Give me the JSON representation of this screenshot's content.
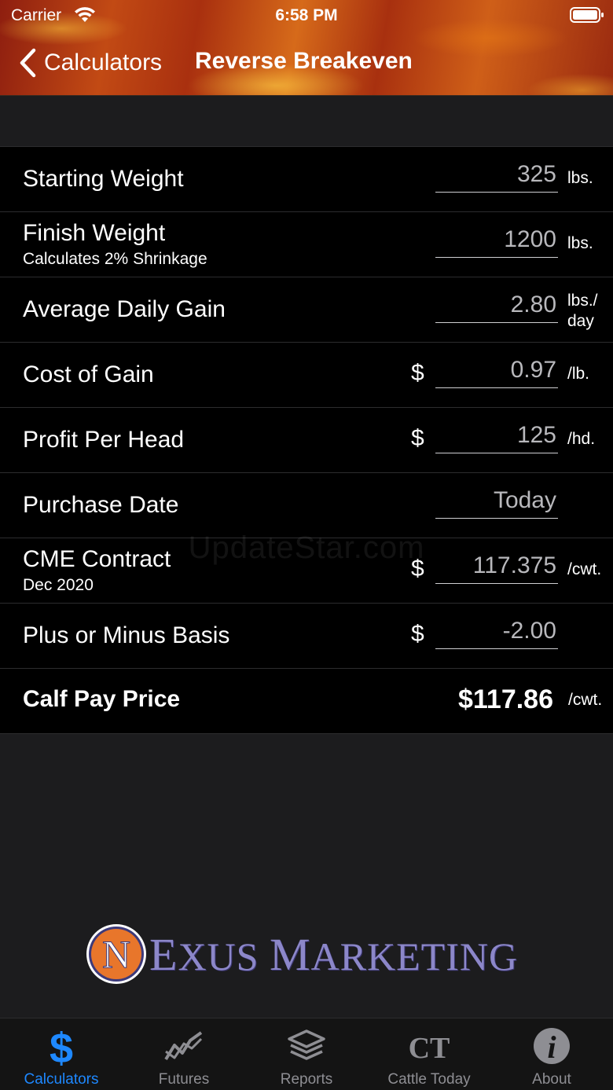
{
  "status_bar": {
    "carrier": "Carrier",
    "time": "6:58 PM"
  },
  "nav": {
    "back_label": "Calculators",
    "title": "Reverse Breakeven"
  },
  "form": {
    "starting_weight": {
      "label": "Starting Weight",
      "value": "325",
      "unit": "lbs."
    },
    "finish_weight": {
      "label": "Finish Weight",
      "sublabel": "Calculates 2% Shrinkage",
      "value": "1200",
      "unit": "lbs."
    },
    "average_daily_gain": {
      "label": "Average Daily Gain",
      "value": "2.80",
      "unit_line1": "lbs./",
      "unit_line2": "day"
    },
    "cost_of_gain": {
      "label": "Cost of Gain",
      "currency": "$",
      "value": "0.97",
      "unit": "/lb."
    },
    "profit_per_head": {
      "label": "Profit Per Head",
      "currency": "$",
      "value": "125",
      "unit": "/hd."
    },
    "purchase_date": {
      "label": "Purchase Date",
      "value": "Today"
    },
    "cme_contract": {
      "label": "CME Contract",
      "sublabel": "Dec 2020",
      "currency": "$",
      "value": "117.375",
      "unit": "/cwt."
    },
    "basis": {
      "label": "Plus or Minus Basis",
      "currency": "$",
      "value": "-2.00"
    }
  },
  "result": {
    "label": "Calf Pay Price",
    "value": "$117.86",
    "unit": "/cwt."
  },
  "watermark": "UpdateStar.com",
  "logo": {
    "letter": "N",
    "text_cap1": "E",
    "text_rest1": "XUS ",
    "text_cap2": "M",
    "text_rest2": "ARKETING"
  },
  "tabs": [
    {
      "label": "Calculators",
      "icon": "dollar-icon",
      "active": true
    },
    {
      "label": "Futures",
      "icon": "chart-line-icon",
      "active": false
    },
    {
      "label": "Reports",
      "icon": "layers-icon",
      "active": false
    },
    {
      "label": "Cattle Today",
      "icon": "ct-icon",
      "icon_text": "CT",
      "active": false
    },
    {
      "label": "About",
      "icon": "info-icon",
      "icon_text": "i",
      "active": false
    }
  ],
  "colors": {
    "accent": "#1e88ff",
    "background": "#1c1c1e",
    "row_background": "#000000",
    "inactive_tab": "#8e8e93",
    "logo_purple": "#8c87c9",
    "logo_orange": "#e8762b"
  }
}
